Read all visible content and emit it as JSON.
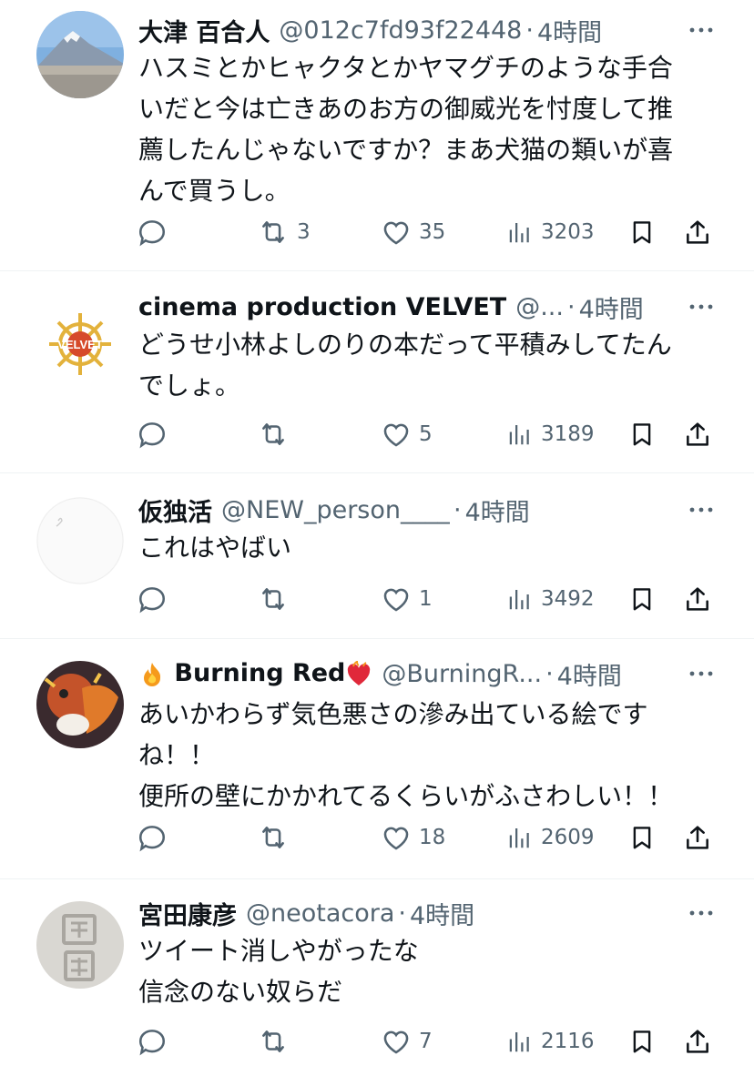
{
  "tweets": [
    {
      "name": "大津 百合人",
      "handle": "@012c7fd93f22448",
      "time": "4時間",
      "text": "ハスミとかヒャクタとかヤマグチのような手合\nいだと今は亡きあのお方の御威光を忖度して推\n薦したんじゃないですか？まあ犬猫の類いが喜\nんで買うし。",
      "reply_count": "",
      "retweet_count": "3",
      "like_count": "35",
      "view_count": "3203",
      "avatar": "mountain-photo"
    },
    {
      "name": "cinema production VELVET",
      "handle": "@...",
      "time": "4時間",
      "text": "どうせ小林よしのりの本だって平積みしてたん\nでしょ。",
      "reply_count": "",
      "retweet_count": "",
      "like_count": "5",
      "view_count": "3189",
      "avatar": "velvet-logo",
      "avatar_text": "VELVET"
    },
    {
      "name": "仮独活",
      "handle": "@NEW_person____",
      "time": "4時間",
      "text": "これはやばい",
      "reply_count": "",
      "retweet_count": "",
      "like_count": "1",
      "view_count": "3492",
      "avatar": "blank-avatar"
    },
    {
      "name": "Burning Red",
      "name_prefix_icon": "fire-emoji",
      "name_suffix_icon": "burning-heart-emoji",
      "handle": "@BurningR...",
      "time": "4時間",
      "text": "あいかわらず気色悪さの滲み出ている絵です\nね！！\n便所の壁にかかれてるくらいがふさわしい！！",
      "reply_count": "",
      "retweet_count": "",
      "like_count": "18",
      "view_count": "2609",
      "avatar": "dragon-art"
    },
    {
      "name": "宮田康彦",
      "handle": "@neotacora",
      "time": "4時間",
      "text": "ツイート消しやがったな\n信念のない奴らだ",
      "reply_count": "",
      "retweet_count": "",
      "like_count": "7",
      "view_count": "2116",
      "avatar": "stone-stamp"
    }
  ],
  "separator": "·",
  "colors": {
    "secondary": "#536471",
    "primary": "#0f1419",
    "border": "#eff3f4"
  }
}
